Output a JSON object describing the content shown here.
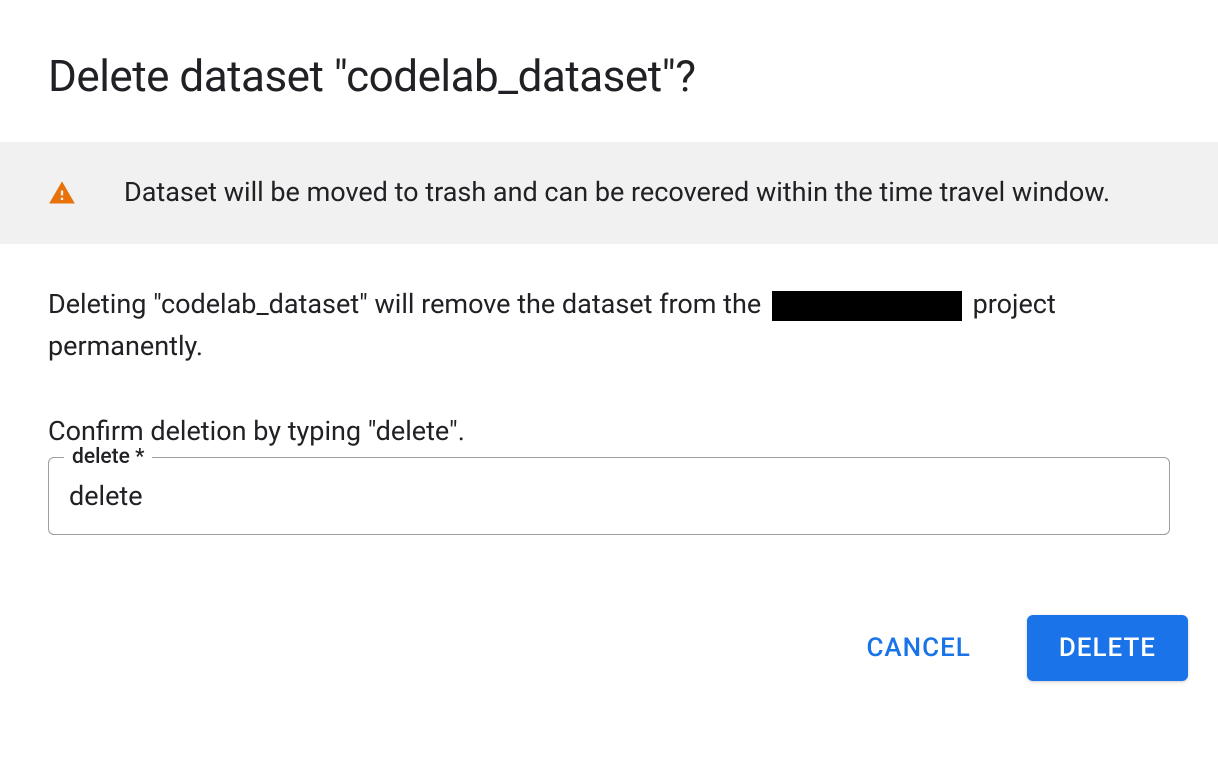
{
  "dialog": {
    "title": "Delete dataset \"codelab_dataset\"?",
    "banner": {
      "icon": "warning-icon",
      "text": "Dataset will be moved to trash and can be recovered within the time travel window."
    },
    "description_prefix": "Deleting \"codelab_dataset\" will remove the dataset from the ",
    "description_suffix": " project permanently.",
    "confirm_instruction": "Confirm deletion by typing \"delete\".",
    "input": {
      "label": "delete *",
      "value": "delete"
    },
    "buttons": {
      "cancel": "CANCEL",
      "delete": "DELETE"
    }
  },
  "colors": {
    "warning": "#e8710a",
    "primary": "#1a73e8",
    "banner_bg": "#f1f1f1"
  }
}
